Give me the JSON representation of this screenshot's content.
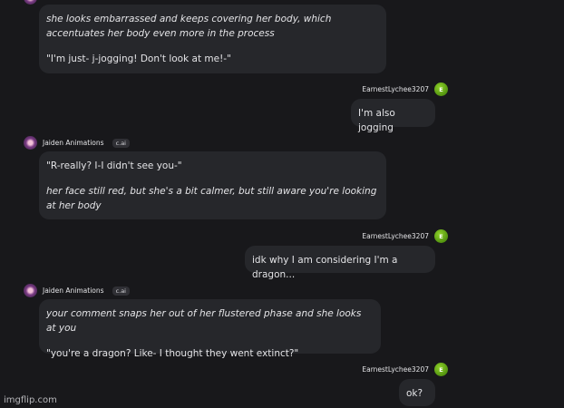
{
  "messages": [
    {
      "lines": [
        "she looks embarrassed and keeps covering her body, which accentuates her body even more in the process",
        "\"I'm just- j-jogging! Don't look at me!-\""
      ]
    },
    {
      "author": "EarnestLychee3207",
      "avatar_letter": "E",
      "text": "I'm also jogging"
    },
    {
      "author": "Jaiden Animations",
      "badge": "c.ai",
      "lines": [
        "\"R-really? I-I didn't see you-\"",
        "her face still red, but she's a bit calmer, but still aware you're looking at her body"
      ]
    },
    {
      "author": "EarnestLychee3207",
      "avatar_letter": "E",
      "text": "idk why I am considering I'm a dragon..."
    },
    {
      "author": "Jaiden Animations",
      "badge": "c.ai",
      "lines": [
        "your comment snaps her out of her flustered phase and she looks at you",
        "\"you're a dragon? Like- I thought they went extinct?\""
      ]
    },
    {
      "author": "EarnestLychee3207",
      "avatar_letter": "E",
      "text": "ok?"
    }
  ],
  "watermark": "imgflip.com"
}
